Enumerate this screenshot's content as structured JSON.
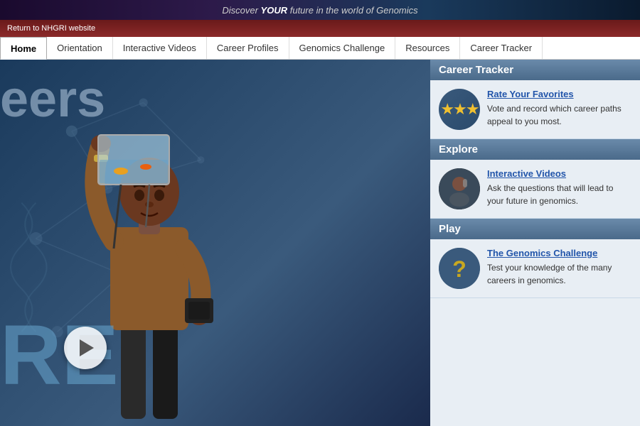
{
  "topBanner": {
    "text": "Discover ",
    "emphasis": "YOUR",
    "textAfter": " future in the world of Genomics"
  },
  "returnBar": {
    "linkText": "Return to NHGRI website"
  },
  "nav": {
    "items": [
      {
        "id": "home",
        "label": "Home",
        "active": true
      },
      {
        "id": "orientation",
        "label": "Orientation",
        "active": false
      },
      {
        "id": "interactive-videos",
        "label": "Interactive Videos",
        "active": false
      },
      {
        "id": "career-profiles",
        "label": "Career Profiles",
        "active": false
      },
      {
        "id": "genomics-challenge",
        "label": "Genomics Challenge",
        "active": false
      },
      {
        "id": "resources",
        "label": "Resources",
        "active": false
      },
      {
        "id": "career-tracker",
        "label": "Career Tracker",
        "active": false
      }
    ]
  },
  "hero": {
    "careersText": "eers",
    "reText": "RE"
  },
  "sidebar": {
    "sections": [
      {
        "id": "career-tracker",
        "header": "Career Tracker",
        "cards": [
          {
            "id": "rate-favorites",
            "iconType": "stars",
            "title": "Rate Your Favorites",
            "description": "Vote and record which career paths appeal to you most."
          }
        ]
      },
      {
        "id": "explore",
        "header": "Explore",
        "cards": [
          {
            "id": "interactive-videos",
            "iconType": "video",
            "title": "Interactive Videos",
            "description": "Ask the questions that will lead to your future in genomics."
          }
        ]
      },
      {
        "id": "play",
        "header": "Play",
        "cards": [
          {
            "id": "genomics-challenge",
            "iconType": "challenge",
            "title": "The Genomics Challenge",
            "description": "Test your knowledge of the many careers in genomics."
          }
        ]
      }
    ]
  }
}
